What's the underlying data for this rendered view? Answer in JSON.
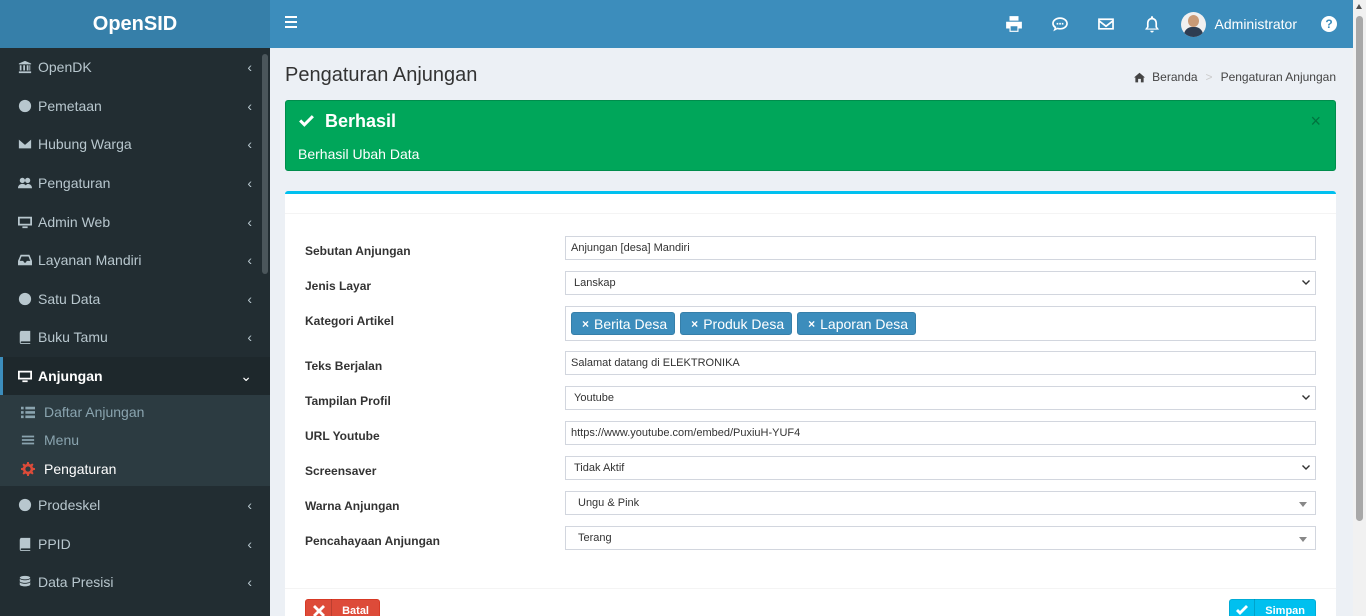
{
  "app": {
    "title": "OpenSID"
  },
  "navbar": {
    "user_name": "Administrator",
    "icons": [
      "print-icon",
      "chat-icon",
      "mail-icon",
      "bell-icon"
    ],
    "help_label": "?"
  },
  "sidebar": {
    "items": [
      {
        "label": "OpenDK",
        "icon": "bank-icon"
      },
      {
        "label": "Pemetaan",
        "icon": "globe-icon"
      },
      {
        "label": "Hubung Warga",
        "icon": "envelope-icon"
      },
      {
        "label": "Pengaturan",
        "icon": "users-icon"
      },
      {
        "label": "Admin Web",
        "icon": "desktop-icon"
      },
      {
        "label": "Layanan Mandiri",
        "icon": "inbox-icon"
      },
      {
        "label": "Satu Data",
        "icon": "globe-icon"
      },
      {
        "label": "Buku Tamu",
        "icon": "book-icon"
      },
      {
        "label": "Anjungan",
        "icon": "desktop-icon"
      }
    ],
    "submenu": [
      {
        "label": "Daftar Anjungan",
        "icon": "list-icon"
      },
      {
        "label": "Menu",
        "icon": "bars-icon"
      },
      {
        "label": "Pengaturan",
        "icon": "gear-icon"
      }
    ],
    "items_after": [
      {
        "label": "Prodeskel",
        "icon": "globe-icon"
      },
      {
        "label": "PPID",
        "icon": "book-icon"
      },
      {
        "label": "Data Presisi",
        "icon": "database-icon"
      }
    ]
  },
  "page": {
    "title": "Pengaturan Anjungan",
    "breadcrumb": {
      "home": "Beranda",
      "current": "Pengaturan Anjungan"
    }
  },
  "alert": {
    "title": "Berhasil",
    "message": "Berhasil Ubah Data",
    "close": "×"
  },
  "form": {
    "sebutan": {
      "label": "Sebutan Anjungan",
      "value": "Anjungan [desa] Mandiri"
    },
    "jenis_layar": {
      "label": "Jenis Layar",
      "value": "Lanskap"
    },
    "kategori": {
      "label": "Kategori Artikel",
      "tags": [
        "Berita Desa",
        "Produk Desa",
        "Laporan Desa"
      ],
      "remove": "×"
    },
    "teks_berjalan": {
      "label": "Teks Berjalan",
      "value": "Salamat datang di ELEKTRONIKA"
    },
    "tampilan_profil": {
      "label": "Tampilan Profil",
      "value": "Youtube"
    },
    "url_youtube": {
      "label": "URL Youtube",
      "value": "https://www.youtube.com/embed/PuxiuH-YUF4"
    },
    "screensaver": {
      "label": "Screensaver",
      "value": "Tidak Aktif"
    },
    "warna": {
      "label": "Warna Anjungan",
      "value": "Ungu & Pink"
    },
    "pencahayaan": {
      "label": "Pencahayaan Anjungan",
      "value": "Terang"
    }
  },
  "buttons": {
    "cancel": "Batal",
    "save": "Simpan"
  },
  "colors": {
    "header": "#3c8dbc",
    "logo": "#367fa9",
    "sidebar": "#222d32",
    "success": "#00a65a",
    "danger": "#dd4b39",
    "info": "#00c0ef"
  }
}
